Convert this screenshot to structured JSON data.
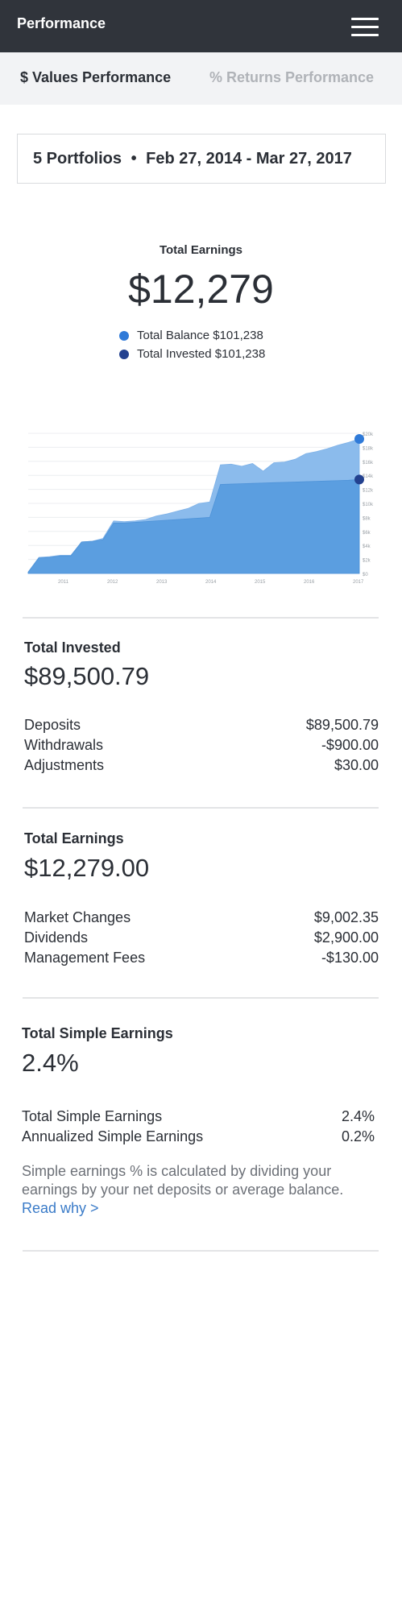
{
  "header": {
    "title": "Performance",
    "menu_icon": "hamburger-menu-icon"
  },
  "tabs": [
    {
      "label": "$ Values Performance",
      "active": true
    },
    {
      "label": "% Returns Performance",
      "active": false
    }
  ],
  "range": {
    "portfolios": "5 Portfolios",
    "separator": "•",
    "dates": "Feb 27, 2014 - Mar 27, 2017"
  },
  "summary": {
    "label": "Total Earnings",
    "value": "$12,279",
    "legend": [
      {
        "label": "Total Balance $101,238",
        "color": "#2f7ad8"
      },
      {
        "label": "Total Invested $101,238",
        "color": "#23418f"
      }
    ]
  },
  "chart_data": {
    "type": "area",
    "x_ticks": [
      "2011",
      "2012",
      "2013",
      "2014",
      "2015",
      "2016",
      "2017"
    ],
    "y_ticks": [
      "$0",
      "$2k",
      "$4k",
      "$6k",
      "$8k",
      "$10k",
      "$12k",
      "$14k",
      "$16k",
      "$18k",
      "$20k"
    ],
    "colors": {
      "balance": "#8bbbec",
      "invested": "#5b9ee0",
      "balance_dot": "#2f7ad8",
      "invested_dot": "#23418f"
    },
    "series": [
      {
        "values": [
          0.2,
          2.3,
          2.4,
          2.6,
          2.6,
          4.5,
          4.6,
          5.0,
          7.5,
          7.4,
          7.5,
          7.7,
          8.2,
          8.5,
          8.9,
          9.3,
          10.0,
          10.2,
          15.5,
          15.6,
          15.3,
          15.7,
          14.6,
          15.8,
          15.9,
          16.3,
          17.1,
          17.4,
          17.8,
          18.3,
          18.7,
          19.2
        ]
      },
      {
        "values": [
          0.2,
          2.2,
          2.3,
          2.5,
          2.5,
          4.5,
          4.6,
          4.8,
          7.2,
          7.2,
          7.3,
          7.4,
          7.5,
          7.6,
          7.7,
          7.8,
          7.9,
          8.0,
          12.7,
          12.75,
          12.8,
          12.85,
          12.9,
          12.95,
          13.0,
          13.05,
          13.1,
          13.15,
          13.2,
          13.25,
          13.3,
          13.4
        ]
      }
    ],
    "ylim": [
      0,
      20
    ]
  },
  "invested": {
    "label": "Total Invested",
    "value": "$89,500.79",
    "rows": [
      {
        "label": "Deposits",
        "value": "$89,500.79"
      },
      {
        "label": "Withdrawals",
        "value": "-$900.00"
      },
      {
        "label": "Adjustments",
        "value": "$30.00"
      }
    ]
  },
  "earnings": {
    "label": "Total Earnings",
    "value": "$12,279.00",
    "rows": [
      {
        "label": "Market Changes",
        "value": "$9,002.35"
      },
      {
        "label": "Dividends",
        "value": "$2,900.00"
      },
      {
        "label": "Management Fees",
        "value": "-$130.00"
      }
    ]
  },
  "simple": {
    "label": "Total Simple Earnings",
    "value": "2.4%",
    "rows": [
      {
        "label": "Total Simple Earnings",
        "value": "2.4%"
      },
      {
        "label": "Annualized Simple Earnings",
        "value": "0.2%"
      }
    ],
    "note": "Simple earnings % is calculated by dividing your earnings by your net deposits or average balance.",
    "link": "Read why >"
  }
}
